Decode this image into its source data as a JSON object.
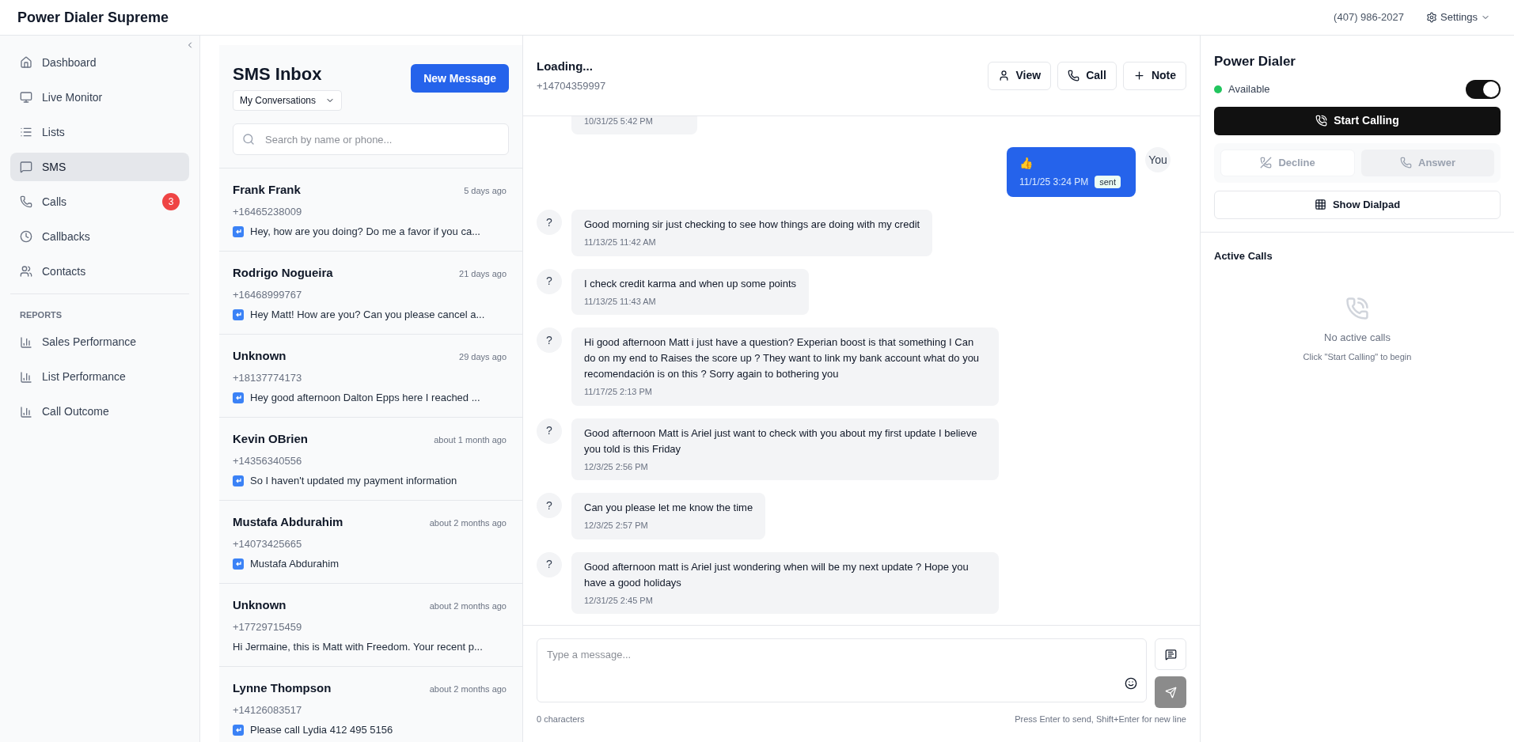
{
  "app": {
    "title": "Power Dialer Supreme",
    "phone": "(407) 986-2027",
    "settings_label": "Settings"
  },
  "sidebar": {
    "items": [
      {
        "label": "Dashboard",
        "selected": false
      },
      {
        "label": "Live Monitor",
        "selected": false
      },
      {
        "label": "Lists",
        "selected": false
      },
      {
        "label": "SMS",
        "selected": true
      },
      {
        "label": "Calls",
        "selected": false,
        "badge": "3"
      },
      {
        "label": "Callbacks",
        "selected": false
      },
      {
        "label": "Contacts",
        "selected": false
      }
    ],
    "section_title": "REPORTS",
    "reports": [
      {
        "label": "Sales Performance",
        "selected": false
      },
      {
        "label": "List Performance",
        "selected": false
      },
      {
        "label": "Call Outcome",
        "selected": false
      }
    ]
  },
  "inbox": {
    "title": "SMS Inbox",
    "filter": "My Conversations",
    "new_button": "New Message",
    "search": {
      "placeholder": "Search by name or phone..."
    },
    "conversations": [
      {
        "name": "Frank Frank",
        "time": "5 days ago",
        "phone": "+16465238009",
        "preview": "Hey, how are you doing? Do me a favor if you ca...",
        "reply_icon": true
      },
      {
        "name": "Rodrigo Nogueira",
        "time": "21 days ago",
        "phone": "+16468999767",
        "preview": "Hey Matt! How are you? Can you please cancel a...",
        "reply_icon": true
      },
      {
        "name": "Unknown",
        "time": "29 days ago",
        "phone": "+18137774173",
        "preview": "Hey good afternoon Dalton Epps here I reached ...",
        "reply_icon": true
      },
      {
        "name": "Kevin OBrien",
        "time": "about 1 month ago",
        "phone": "+14356340556",
        "preview": "So I haven't updated my payment information",
        "reply_icon": true
      },
      {
        "name": "Mustafa Abdurahim",
        "time": "about 2 months ago",
        "phone": "+14073425665",
        "preview": "Mustafa Abdurahim",
        "reply_icon": true
      },
      {
        "name": "Unknown",
        "time": "about 2 months ago",
        "phone": "+17729715459",
        "preview": "Hi Jermaine, this is Matt with Freedom. Your recent p...",
        "reply_icon": false
      },
      {
        "name": "Lynne Thompson",
        "time": "about 2 months ago",
        "phone": "+14126083517",
        "preview": "Please call Lydia 412 495 5156",
        "reply_icon": true
      }
    ]
  },
  "chat": {
    "name": "Loading...",
    "phone": "+14704359997",
    "actions": [
      {
        "label": "View"
      },
      {
        "label": "Call"
      },
      {
        "label": "Note"
      }
    ],
    "messages": [
      {
        "kind": "incoming",
        "time": "10/31/25 5:42 PM"
      },
      {
        "kind": "outgoing",
        "text": "👍",
        "time": "11/1/25 3:24 PM",
        "status": "sent",
        "avatar": "You"
      },
      {
        "kind": "incoming",
        "avatar": "?",
        "text": "Good morning sir just checking to see how things are doing with my credit",
        "time": "11/13/25 11:42 AM"
      },
      {
        "kind": "incoming",
        "avatar": "?",
        "text": "I check credit karma and when up some points",
        "time": "11/13/25 11:43 AM"
      },
      {
        "kind": "incoming",
        "avatar": "?",
        "text": "Hi good afternoon Matt i just have a question? Experian boost is that something I Can do on my end to Raises the score up ? They want to link my bank account what do you recomendación is on this ? Sorry again to bothering you",
        "time": "11/17/25 2:13 PM"
      },
      {
        "kind": "incoming",
        "avatar": "?",
        "text": "Good afternoon Matt is Ariel just want to check with you about my first update I believe you told is this Friday",
        "time": "12/3/25 2:56 PM"
      },
      {
        "kind": "incoming",
        "avatar": "?",
        "text": "Can you please let me know the time",
        "time": "12/3/25 2:57 PM"
      },
      {
        "kind": "incoming",
        "avatar": "?",
        "text": "Good afternoon matt is Ariel just wondering when will be my next update ? Hope you have a good holidays",
        "time": "12/31/25 2:45 PM"
      }
    ],
    "composer": {
      "placeholder": "Type a message...",
      "count": "0 characters",
      "hint": "Press Enter to send, Shift+Enter for new line",
      "send_disabled": true
    }
  },
  "dialer": {
    "title": "Power Dialer",
    "status": "Available",
    "toggle_on": true,
    "start_button": "Start Calling",
    "call_buttons": [
      {
        "label": "Decline",
        "kind": "decline",
        "disabled": true
      },
      {
        "label": "Answer",
        "kind": "answer",
        "disabled": true
      }
    ],
    "dialpad_button": "Show Dialpad",
    "active_title": "Active Calls",
    "empty_title": "No active calls",
    "empty_hint": "Click \"Start Calling\" to begin"
  }
}
